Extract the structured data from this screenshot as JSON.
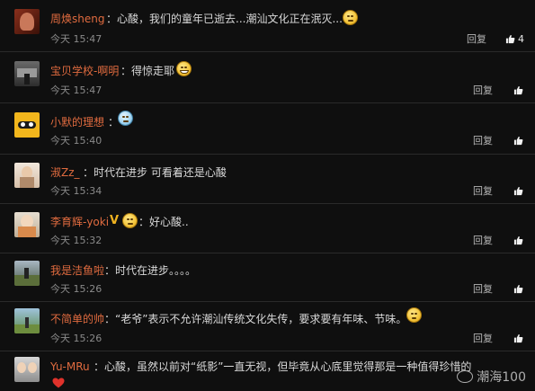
{
  "comments": [
    {
      "name": "周焕sheng",
      "text": "：心酸，我们的童年已逝去...潮汕文化正在泯灭...",
      "time": "今天 15:47",
      "reply": "回复",
      "likes": "4"
    },
    {
      "name": "宝贝学校-啊明",
      "text": "：得惊走耶",
      "time": "今天 15:47",
      "reply": "回复"
    },
    {
      "name": "小默的理想",
      "text": "：",
      "time": "今天 15:40",
      "reply": "回复"
    },
    {
      "name": "淑Zz_",
      "text": "：时代在进步 可看着还是心酸",
      "time": "今天 15:34",
      "reply": "回复"
    },
    {
      "name": "李育辉-yoki",
      "text": "：好心酸..",
      "time": "今天 15:32",
      "reply": "回复"
    },
    {
      "name": "我是洁鱼啦",
      "text": "：时代在进步。。。。",
      "time": "今天 15:26",
      "reply": "回复"
    },
    {
      "name": "不简单的帅",
      "text": "：“老爷”表示不允许潮汕传统文化失传，要求要有年味、节味。",
      "time": "今天 15:26",
      "reply": "回复"
    },
    {
      "name": "Yu-MRu",
      "text": "：心酸，虽然以前对“纸影”一直无视，但毕竟从心底里觉得那是一种值得珍惜的",
      "time": "",
      "reply": ""
    }
  ],
  "watermark": "潮海100",
  "icons": {
    "like": "thumbs-up-icon",
    "emoji": "smiley-emoji-icon",
    "heart": "heart-emoji-icon",
    "watermark": "wechat-logo-icon"
  },
  "colors": {
    "background": "#0f0f0f",
    "name": "#e06b3f",
    "text": "#d9d9d9",
    "time": "#8a8a8a"
  }
}
